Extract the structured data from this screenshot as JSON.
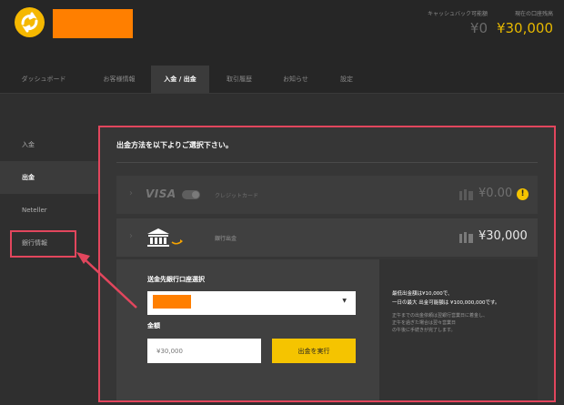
{
  "header": {
    "logo_icon": "exchange-arrows-icon",
    "cashback": {
      "label": "キャッシュバック可能額",
      "value": "¥0"
    },
    "account_balance": {
      "label": "現在の口座残高",
      "value": "¥30,000"
    }
  },
  "tabs": [
    {
      "label": "ダッシュボード"
    },
    {
      "label": "お客様情報"
    },
    {
      "label": "入金 / 出金"
    },
    {
      "label": "取引履歴"
    },
    {
      "label": "お知らせ"
    },
    {
      "label": "設定"
    }
  ],
  "sidebar": {
    "items": [
      {
        "label": "入金"
      },
      {
        "label": "出金"
      },
      {
        "label": "Neteller"
      },
      {
        "label": "銀行情報"
      }
    ]
  },
  "panel": {
    "title": "出金方法を以下よりご選択下さい。",
    "methods": {
      "card": {
        "brand": "VISA",
        "name": "クレジットカード",
        "amount": "¥0.00",
        "alert_icon": "exclamation-icon"
      },
      "bank": {
        "icon": "bank-building-icon",
        "name": "銀行出金",
        "amount": "¥30,000"
      }
    },
    "form": {
      "account_label": "送金先銀行口座選択",
      "amount_label": "金額",
      "amount_placeholder": "¥30,000",
      "submit_label": "出金を実行"
    },
    "info": {
      "line1": "最低出金額は¥10,000で、",
      "line2": "一日の最大 出金可能額は ¥100,000,000です。",
      "note1": "正午までの出金依頼は翌銀行営業日に着金し、",
      "note2": "正午を過ぎた場合は翌々営業日",
      "note3": "の午後に手続きが完了します。"
    }
  },
  "colors": {
    "accent": "#f5c400",
    "annotation": "#e2465d",
    "redaction": "#ff7f00"
  }
}
